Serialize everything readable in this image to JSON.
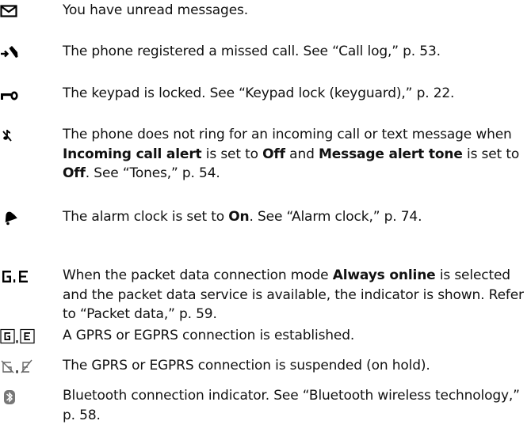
{
  "indicators": [
    {
      "icon": "envelope-icon",
      "segments": [
        {
          "t": "You have unread messages.",
          "b": false
        }
      ]
    },
    {
      "icon": "missed-call-icon",
      "segments": [
        {
          "t": "The phone registered a missed call. See “Call log,” p. 53.",
          "b": false
        }
      ]
    },
    {
      "icon": "key-lock-icon",
      "segments": [
        {
          "t": "The keypad is locked. See “Keypad lock (keyguard),” p. 22.",
          "b": false
        }
      ]
    },
    {
      "icon": "silent-note-icon",
      "segments": [
        {
          "t": "The phone does not ring for an incoming call or text message when ",
          "b": false
        },
        {
          "t": "Incoming call alert",
          "b": true
        },
        {
          "t": " is set to ",
          "b": false
        },
        {
          "t": "Off",
          "b": true
        },
        {
          "t": " and ",
          "b": false
        },
        {
          "t": "Message alert tone",
          "b": true
        },
        {
          "t": " is set to ",
          "b": false
        },
        {
          "t": "Off",
          "b": true
        },
        {
          "t": ". See “Tones,” p. 54.",
          "b": false
        }
      ]
    },
    {
      "icon": "alarm-bell-icon",
      "segments": [
        {
          "t": "The alarm clock is set to ",
          "b": false
        },
        {
          "t": "On",
          "b": true
        },
        {
          "t": ". See “Alarm clock,” p. 74.",
          "b": false
        }
      ]
    },
    {
      "icon": "gprs-egprs-icon",
      "segments": [
        {
          "t": "When the packet data connection mode ",
          "b": false
        },
        {
          "t": "Always online",
          "b": true
        },
        {
          "t": " is selected and the packet data service is available, the indicator is shown. Refer to “Packet data,” p. 59.",
          "b": false
        }
      ]
    },
    {
      "icon": "gprs-egprs-connected-icon",
      "segments": [
        {
          "t": "A GPRS or EGPRS connection is established.",
          "b": false
        }
      ]
    },
    {
      "icon": "gprs-egprs-suspended-icon",
      "segments": [
        {
          "t": "The GPRS or EGPRS connection is suspended (on hold).",
          "b": false
        }
      ]
    },
    {
      "icon": "bluetooth-icon",
      "segments": [
        {
          "t": "Bluetooth connection indicator. See “Bluetooth wireless technology,” p. 58.",
          "b": false
        }
      ]
    }
  ]
}
